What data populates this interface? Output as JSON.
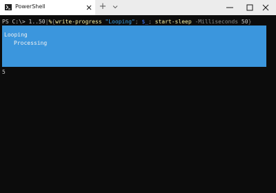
{
  "window": {
    "tab_title": "PowerShell",
    "new_tab_glyph": "+",
    "dropdown_glyph": "⌄",
    "tab_icon": "powershell-icon",
    "controls": [
      "minimize-icon",
      "maximize-icon",
      "close-icon"
    ]
  },
  "terminal": {
    "command": {
      "prompt": "PS C:\\> ",
      "range": "1..50",
      "pipe": "|",
      "foreach": "%",
      "brace_open": "{",
      "cmd1": "write-progress",
      "space": " ",
      "arg1": "\"Looping\"",
      "sep": "; ",
      "var": "$_",
      "cmd2": "start-sleep",
      "param": "-Milliseconds",
      "arg2": "50",
      "brace_close": "}"
    },
    "progress": {
      "activity": "Looping",
      "status": "Processing"
    },
    "output": "5"
  },
  "colors": {
    "terminal_bg": "#0c0c0c",
    "progress_bg": "#3b96dd",
    "titlebar_bg": "#ececec",
    "string": "#3aa0e8",
    "command": "#f9f1a5"
  }
}
